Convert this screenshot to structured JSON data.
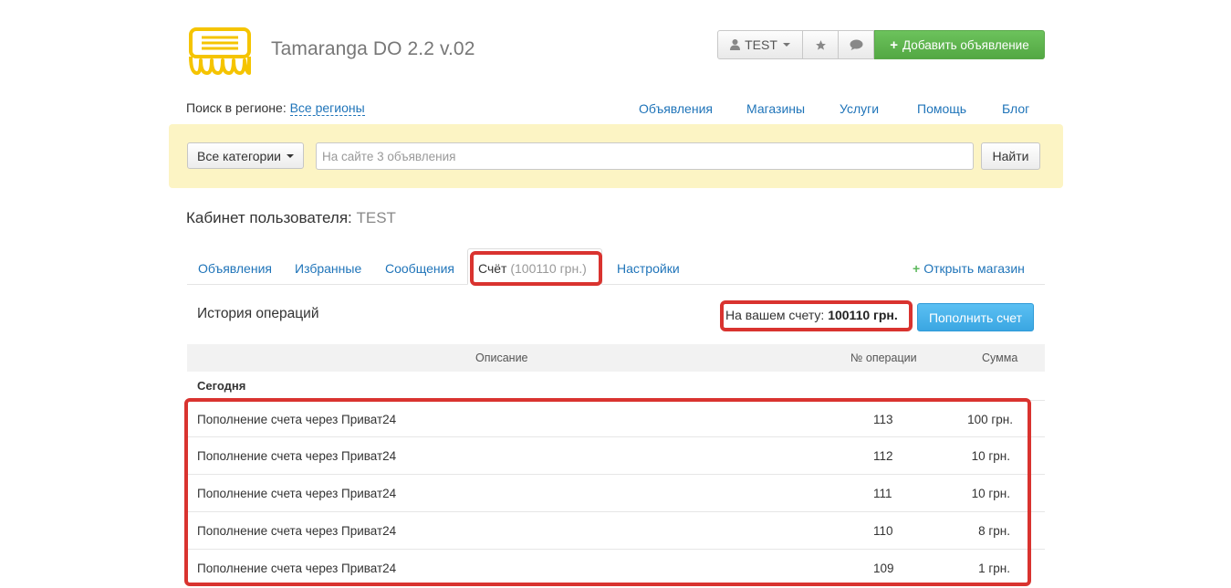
{
  "header": {
    "site_title": "Tamaranga DO 2.2 v.02",
    "user_label": "TEST",
    "add_listing_label": "Добавить объявление"
  },
  "region": {
    "prefix": "Поиск в регионе:",
    "value": "Все регионы"
  },
  "topnav": [
    "Объявления",
    "Магазины",
    "Услуги",
    "Помощь",
    "Блог"
  ],
  "search": {
    "category_label": "Все категории",
    "placeholder": "На сайте 3 объявления",
    "button_label": "Найти"
  },
  "cabinet": {
    "title": "Кабинет пользователя:",
    "username": "TEST"
  },
  "tabs": {
    "listings": "Объявления",
    "favorites": "Избранные",
    "messages": "Сообщения",
    "account": "Счёт",
    "account_amount": "(100110 грн.)",
    "settings": "Настройки",
    "open_shop": "Открыть магазин"
  },
  "history": {
    "title": "История операций",
    "balance_prefix": "На вашем счету:",
    "balance_value": "100110 грн.",
    "topup_label": "Пополнить счет"
  },
  "table": {
    "columns": [
      "Описание",
      "№ операции",
      "Сумма"
    ],
    "group_label": "Сегодня",
    "rows": [
      {
        "description": "Пополнение счета через Приват24",
        "op": "113",
        "sum": "100 грн."
      },
      {
        "description": "Пополнение счета через Приват24",
        "op": "112",
        "sum": "10 грн."
      },
      {
        "description": "Пополнение счета через Приват24",
        "op": "111",
        "sum": "10 грн."
      },
      {
        "description": "Пополнение счета через Приват24",
        "op": "110",
        "sum": "8 грн."
      },
      {
        "description": "Пополнение счета через Приват24",
        "op": "109",
        "sum": "1 грн."
      }
    ]
  },
  "colors": {
    "accent_link": "#1f74b9",
    "add_button_green": "#5cb85c",
    "topup_blue": "#3aa6e2",
    "highlight_red": "#d9332f",
    "search_band": "#fcf4c4"
  }
}
